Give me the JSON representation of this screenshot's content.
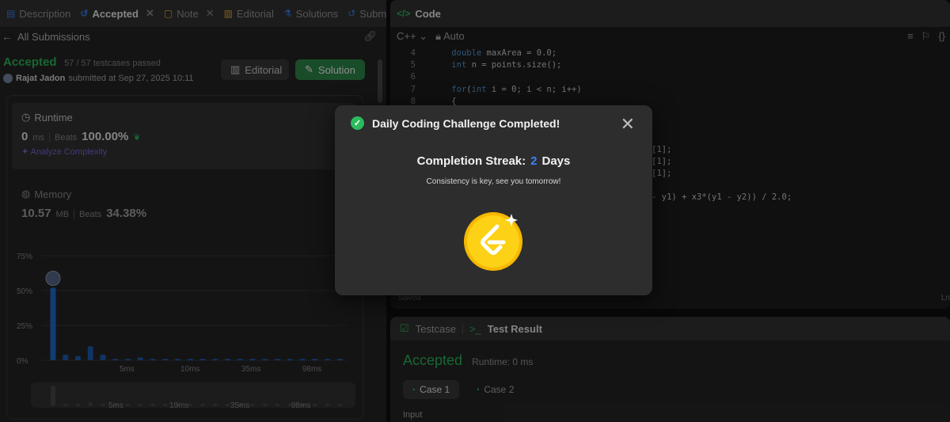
{
  "tabs": [
    {
      "label": "Description",
      "icon": "description-icon"
    },
    {
      "label": "Accepted",
      "icon": "history-icon",
      "active": true,
      "closable": true
    },
    {
      "label": "Note",
      "icon": "note-icon",
      "closable": true
    },
    {
      "label": "Editorial",
      "icon": "book-icon"
    },
    {
      "label": "Solutions",
      "icon": "flask-icon"
    },
    {
      "label": "Submissions",
      "icon": "history-icon"
    }
  ],
  "submission": {
    "back_label": "All Submissions",
    "status": "Accepted",
    "testcases": "57 / 57 testcases passed",
    "user": "Rajat Jadon",
    "submitted": "submitted at Sep 27, 2025 10:11",
    "editorial_btn": "Editorial",
    "solution_btn": "Solution"
  },
  "runtime": {
    "label": "Runtime",
    "value": "0",
    "unit": "ms",
    "beats_label": "Beats",
    "beats_value": "100.00%",
    "analyze": "Analyze Complexity"
  },
  "memory": {
    "label": "Memory",
    "value": "10.57",
    "unit": "MB",
    "beats_label": "Beats",
    "beats_value": "34.38%"
  },
  "chart_data": {
    "type": "bar",
    "y_ticks": [
      "75%",
      "50%",
      "25%",
      "0%"
    ],
    "ylim": [
      0,
      75
    ],
    "x_ticks": [
      "5ms",
      "10ms",
      "35ms",
      "98ms"
    ],
    "values": [
      52,
      4,
      3,
      10,
      4,
      1,
      1,
      2,
      1,
      1,
      1,
      1,
      1,
      1,
      1,
      1,
      1,
      1,
      1,
      1,
      1,
      1,
      1,
      1
    ],
    "highlight_index": 0,
    "mini_x_ticks": [
      "5ms",
      "10ms",
      "35ms",
      "98ms"
    ]
  },
  "code_panel": {
    "title": "Code",
    "language": "C++",
    "mode": "Auto",
    "saved": "Saved",
    "status_right": "Ln",
    "lines": [
      {
        "n": "4",
        "text": "    double maxArea = 0.0;"
      },
      {
        "n": "5",
        "text": "    int n = points.size();"
      },
      {
        "n": "6",
        "text": ""
      },
      {
        "n": "7",
        "text": "    for(int i = 0; i < n; i++)"
      },
      {
        "n": "8",
        "text": "    {"
      },
      {
        "n": "",
        "text": ""
      },
      {
        "n": "",
        "text": ""
      },
      {
        "n": "",
        "text": ""
      },
      {
        "n": "",
        "text": "                                 = points[i][1];"
      },
      {
        "n": "",
        "text": "                                 = points[j][1];"
      },
      {
        "n": "",
        "text": "                                 = points[k][1];"
      },
      {
        "n": "",
        "text": ""
      },
      {
        "n": "",
        "text": "                               y3) + x2*(y3 - y1) + x3*(y1 - y2)) / 2.0;"
      },
      {
        "n": "",
        "text": ""
      },
      {
        "n": "",
        "text": "                                  ;"
      }
    ]
  },
  "test_panel": {
    "testcase_tab": "Testcase",
    "result_tab": "Test Result",
    "status": "Accepted",
    "runtime": "Runtime: 0 ms",
    "cases": [
      "Case 1",
      "Case 2"
    ],
    "input_label": "Input"
  },
  "modal": {
    "title": "Daily Coding Challenge Completed!",
    "streak_label": "Completion Streak:",
    "streak_value": "2",
    "streak_unit": "Days",
    "message": "Consistency is key, see you tomorrow!",
    "accent": "#3b82f6",
    "success": "#2cbb5d",
    "coin_color": "#fcd116"
  }
}
